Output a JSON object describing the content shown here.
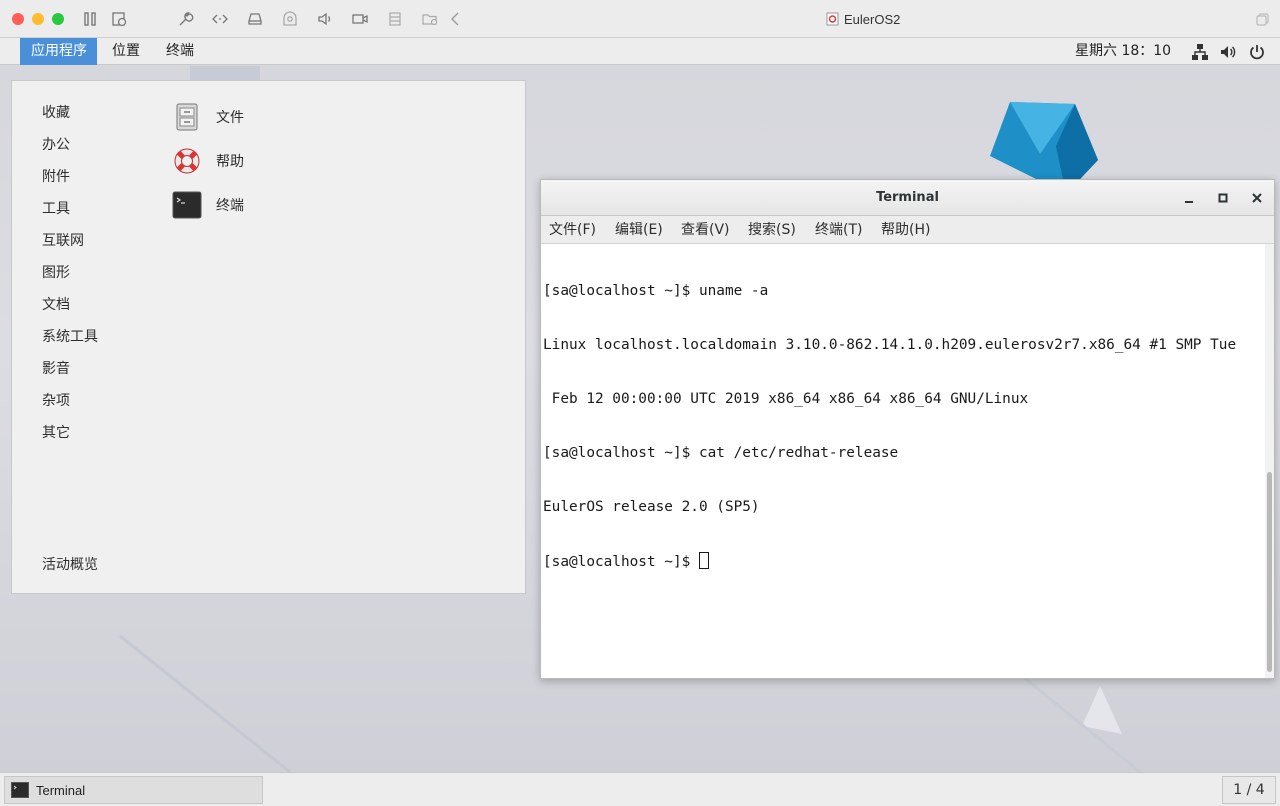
{
  "host_window": {
    "title": "EulerOS2",
    "traffic_lights": [
      "#ff5f57",
      "#febc2e",
      "#28c840"
    ]
  },
  "topbar": {
    "menus": [
      "应用程序",
      "位置",
      "终端"
    ],
    "clock": "星期六 18：10",
    "accent": "#4a90d9"
  },
  "apps_menu": {
    "categories": [
      "收藏",
      "办公",
      "附件",
      "工具",
      "互联网",
      "图形",
      "文档",
      "系统工具",
      "影音",
      "杂项",
      "其它"
    ],
    "apps": [
      "文件",
      "帮助",
      "终端"
    ],
    "activities": "活动概览"
  },
  "terminal": {
    "title": "Terminal",
    "menus": [
      "文件(F)",
      "编辑(E)",
      "查看(V)",
      "搜索(S)",
      "终端(T)",
      "帮助(H)"
    ],
    "lines": [
      "[sa@localhost ~]$ uname -a",
      "Linux localhost.localdomain 3.10.0-862.14.1.0.h209.eulerosv2r7.x86_64 #1 SMP Tue",
      " Feb 12 00:00:00 UTC 2019 x86_64 x86_64 x86_64 GNU/Linux",
      "[sa@localhost ~]$ cat /etc/redhat-release",
      "EulerOS release 2.0 (SP5)"
    ],
    "prompt": "[sa@localhost ~]$ "
  },
  "taskbar": {
    "task": "Terminal",
    "workspace": "1 / 4"
  }
}
